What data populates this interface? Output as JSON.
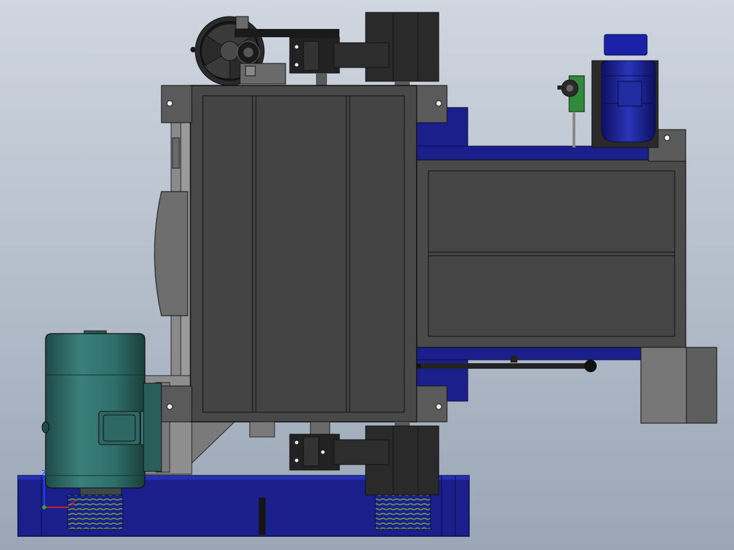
{
  "viewport": {
    "background_top": "#cfd6e0",
    "background_bottom": "#9aa6b6"
  },
  "colors": {
    "frame_gray": "#4a4a4a",
    "frame_dark": "#3c3c3c",
    "frame_light": "#6a6a6a",
    "plate_gray": "#6e6e6e",
    "base_blue": "#1a1f8c",
    "base_blue_dark": "#0d1060",
    "motor_teal": "#2f6e6a",
    "motor_teal_dark": "#1f4a47",
    "spring_green": "#4f7a3a",
    "gear_green": "#2f8a3a",
    "black": "#111111",
    "bolt_white": "#f2f2f2"
  },
  "triad": {
    "icon": "coordinate-triad-icon",
    "z_label": "Z",
    "x_label": "X",
    "z_color": "#2244ff",
    "x_color": "#cc2222"
  },
  "components": [
    "main-housing",
    "discharge-chute",
    "base-frame",
    "main-motor",
    "top-pulley",
    "top-vibrator-mount",
    "bottom-vibrator-mount",
    "gear-motor",
    "side-guard",
    "springs"
  ]
}
